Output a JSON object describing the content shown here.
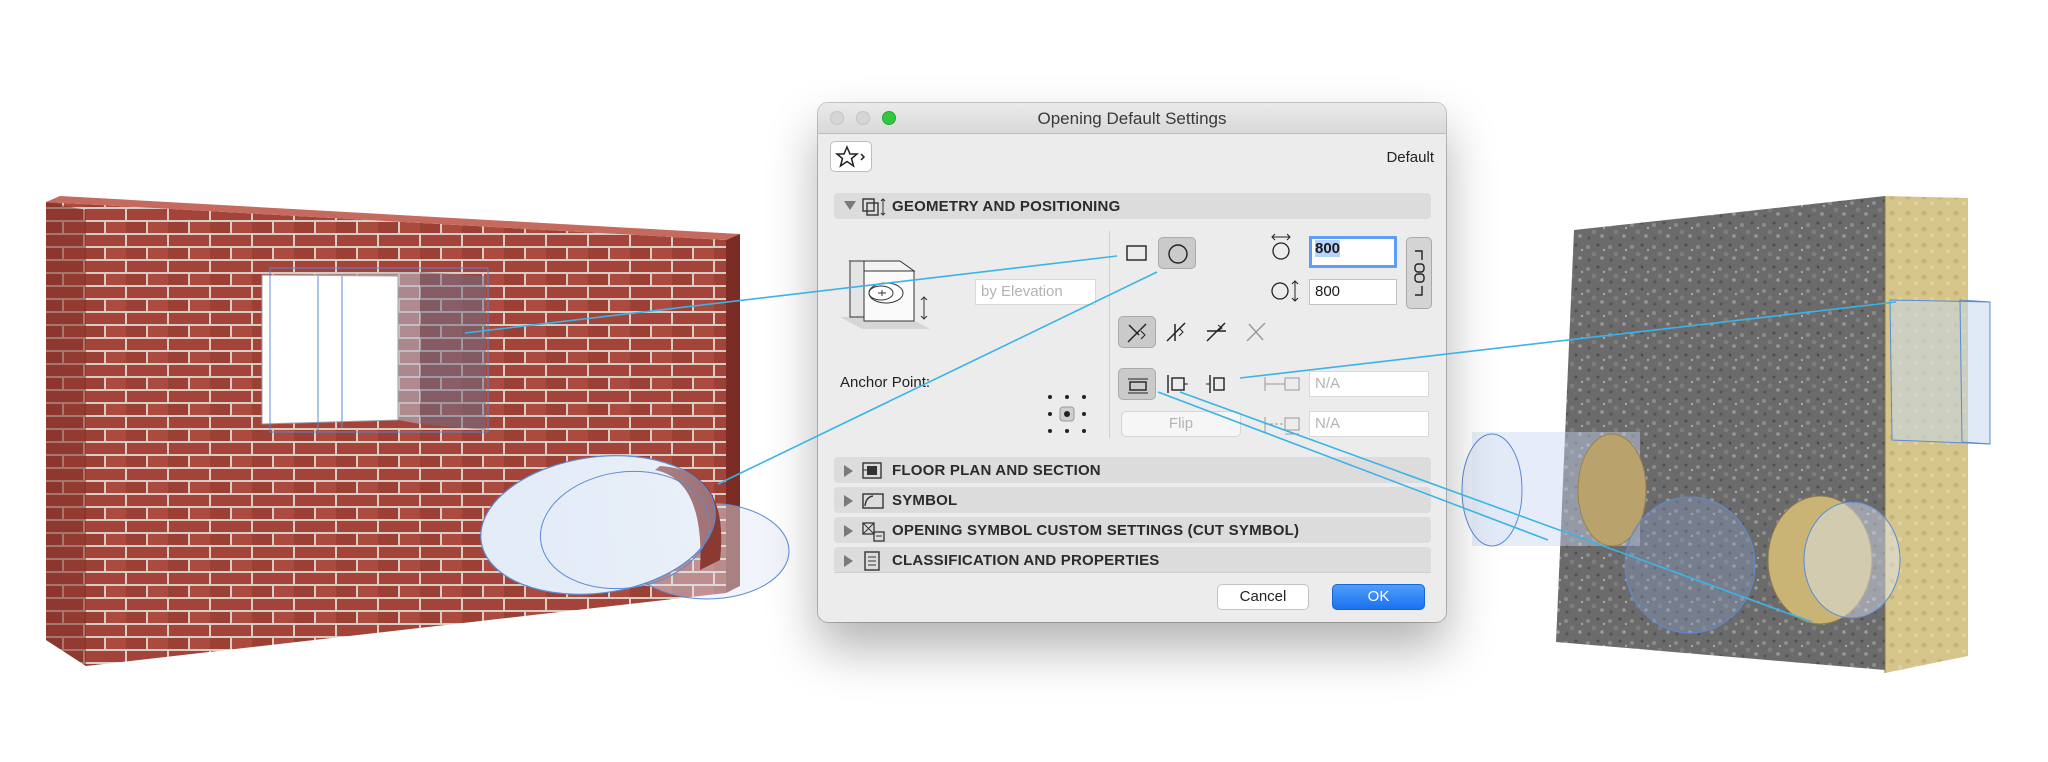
{
  "dialog": {
    "title": "Opening Default Settings",
    "default_label": "Default",
    "sections": [
      {
        "label": "GEOMETRY AND POSITIONING",
        "expanded": true
      },
      {
        "label": "FLOOR PLAN AND SECTION",
        "expanded": false
      },
      {
        "label": "SYMBOL",
        "expanded": false
      },
      {
        "label": "OPENING SYMBOL CUSTOM SETTINGS (CUT SYMBOL)",
        "expanded": false
      },
      {
        "label": "CLASSIFICATION AND PROPERTIES",
        "expanded": false
      }
    ],
    "geometry": {
      "elevation_placeholder": "by Elevation",
      "width_value": "800",
      "height_value": "800",
      "anchor_label": "Anchor Point:",
      "flip_label": "Flip",
      "offset_value_1": "N/A",
      "offset_value_2": "N/A",
      "shape_selected": "circle"
    },
    "buttons": {
      "cancel": "Cancel",
      "ok": "OK"
    }
  },
  "colors": {
    "accent": "#1b72f0",
    "callout_line": "#3ab4e6",
    "brick": "#a4443a",
    "mortar": "#d9cfc7",
    "insulation": "#d8c88c"
  }
}
